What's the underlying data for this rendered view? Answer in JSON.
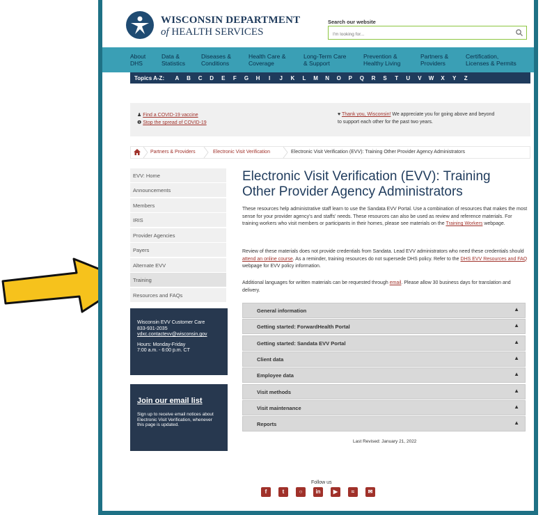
{
  "header": {
    "brand_line1": "WISCONSIN DEPARTMENT",
    "brand_line2_prefix": "of",
    "brand_line2": "HEALTH SERVICES",
    "search_label": "Search our website",
    "search_placeholder": "I'm looking for..."
  },
  "nav": [
    {
      "l1": "About",
      "l2": "DHS"
    },
    {
      "l1": "Data &",
      "l2": "Statistics"
    },
    {
      "l1": "Diseases &",
      "l2": "Conditions"
    },
    {
      "l1": "Health Care &",
      "l2": "Coverage"
    },
    {
      "l1": "Long-Term Care",
      "l2": "& Support"
    },
    {
      "l1": "Prevention &",
      "l2": "Healthy Living"
    },
    {
      "l1": "Partners &",
      "l2": "Providers"
    },
    {
      "l1": "Certification,",
      "l2": "Licenses & Permits"
    }
  ],
  "topics": {
    "label": "Topics A-Z:",
    "letters": [
      "A",
      "B",
      "C",
      "D",
      "E",
      "F",
      "G",
      "H",
      "I",
      "J",
      "K",
      "L",
      "M",
      "N",
      "O",
      "P",
      "Q",
      "R",
      "S",
      "T",
      "U",
      "V",
      "W",
      "X",
      "Y",
      "Z"
    ]
  },
  "notice": {
    "link1": "Find a COVID-19 vaccine",
    "link2": "Stop the spread of COVID-19",
    "thanks_link": "Thank you, Wisconsin!",
    "thanks_text": "We appreciate you for going above and beyond",
    "thanks_text2": "to support each other for the past two years."
  },
  "breadcrumb": {
    "items": [
      "Partners & Providers",
      "Electronic Visit Verification",
      "Electronic Visit Verification (EVV): Training Other Provider Agency Administrators"
    ]
  },
  "sidebar": {
    "items": [
      "EVV: Home",
      "Announcements",
      "Members",
      "IRIS",
      "Provider Agencies",
      "Payers",
      "Alternate EVV",
      "Training",
      "Resources and FAQs"
    ]
  },
  "care_card": {
    "title": "Wisconsin EVV Customer Care",
    "phone": "833-931-2035",
    "email": "vdxc.contactevv@wisconsin.gov",
    "hours1": "Hours: Monday-Friday",
    "hours2": "7:00 a.m. - 6:00 p.m. CT"
  },
  "email_card": {
    "title": "Join our email list",
    "text": "Sign up to receive email notices about Electronic Visit Verification, whenever this page is updated."
  },
  "main": {
    "title": "Electronic Visit Verification (EVV): Training Other Provider Agency Administrators",
    "p1": "These resources help administrative staff learn to use the Sandata EVV Portal. Use a combination of resources that makes the most sense for your provider agency's and staffs' needs. These resources can also be used as review and reference materials. For training workers who visit members or participants in their homes, please see materials on the",
    "p1_link": "Training Workers",
    "p1_end": "webpage.",
    "p2_a": "Review of these materials does not provide credentials from Sandata. Lead EVV administrators who need these credentials should",
    "p2_link1": "attend an online course",
    "p2_b": ". As a reminder, training resources do not supersede DHS policy. Refer to the",
    "p2_link2": "DHS EVV Resources and FAQ",
    "p2_c": "webpage for EVV policy information.",
    "p3_a": "Additional languages for written materials can be requested through",
    "p3_link": "email",
    "p3_b": ". Please allow 30 business days for translation and delivery.",
    "accordions": [
      "General information",
      "Getting started: ForwardHealth Portal",
      "Getting started: Sandata EVV Portal",
      "Client data",
      "Employee data",
      "Visit methods",
      "Visit maintenance",
      "Reports"
    ],
    "last_revised": "Last Revised: January 21, 2022"
  },
  "footer": {
    "follow": "Follow us",
    "social": [
      "facebook-icon",
      "twitter-icon",
      "instagram-icon",
      "linkedin-icon",
      "youtube-icon",
      "rss-icon",
      "email-icon"
    ]
  },
  "colors": {
    "nav": "#3a9fb5",
    "navy": "#1f3b5c",
    "link": "#a0312a",
    "frame": "#1e7185",
    "arrow": "#f6c21c"
  }
}
